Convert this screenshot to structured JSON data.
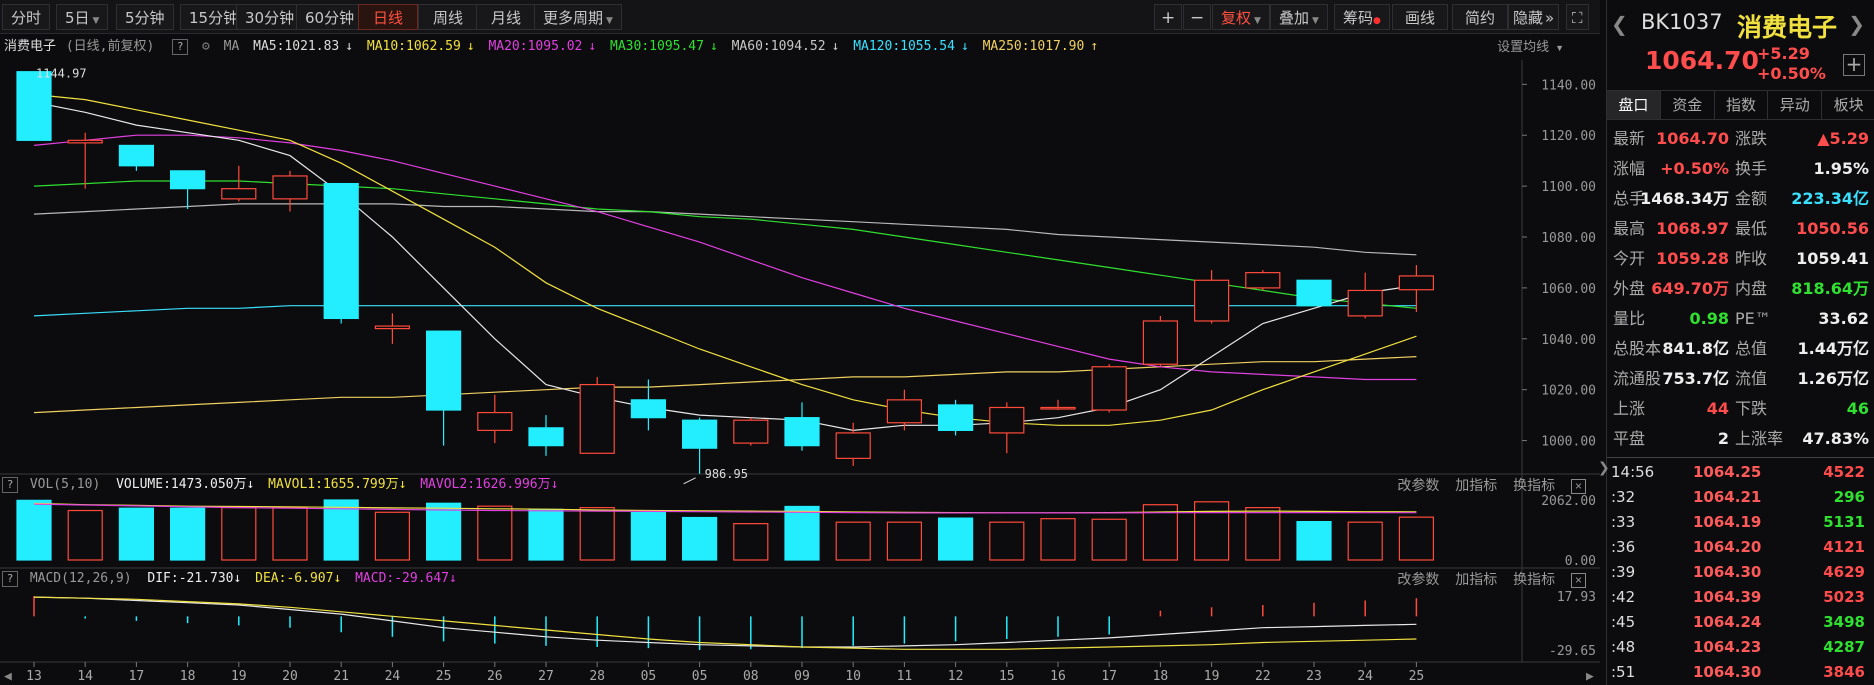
{
  "toolbar": {
    "periods": [
      "分时",
      "5日",
      "5分钟",
      "15分钟",
      "30分钟",
      "60分钟",
      "日线",
      "周线",
      "月线",
      "更多周期"
    ],
    "active_period": "日线",
    "fuquan": "复权",
    "diejia": "叠加",
    "chouma": "筹码",
    "huaxian": "画线",
    "jianyue": "简约",
    "yincang": "隐藏"
  },
  "ma": {
    "name": "消费电子",
    "mode": "(日线,前复权)",
    "label": "MA",
    "ma5": "MA5:1021.83",
    "ma10": "MA10:1062.59",
    "ma20": "MA20:1095.02",
    "ma30": "MA30:1095.47",
    "ma60": "MA60:1094.52",
    "ma120": "MA120:1055.54",
    "ma250": "MA250:1017.90",
    "settings": "设置均线"
  },
  "vol": {
    "title": "VOL(5,10)",
    "volume": "VOLUME:1473.050万",
    "mavol1": "MAVOL1:1655.799万",
    "mavol2": "MAVOL2:1626.996万",
    "ticks": [
      "2062.00",
      "0.00"
    ]
  },
  "macd": {
    "title": "MACD(12,26,9)",
    "dif": "DIF:-21.730",
    "dea": "DEA:-6.907",
    "macd": "MACD:-29.647",
    "ticks": [
      "17.93",
      "-29.65"
    ]
  },
  "sub_actions": [
    "改参数",
    "加指标",
    "换指标"
  ],
  "price_axis": [
    "1140.00",
    "1120.00",
    "1100.00",
    "1080.00",
    "1060.00",
    "1040.00",
    "1020.00",
    "1000.00"
  ],
  "annot": {
    "high": "1144.97",
    "low": "986.95"
  },
  "date_axis": [
    "13",
    "14",
    "17",
    "18",
    "19",
    "20",
    "21",
    "24",
    "25",
    "26",
    "27",
    "28",
    "05",
    "05",
    "08",
    "09",
    "10",
    "11",
    "12",
    "15",
    "16",
    "17",
    "18",
    "19",
    "22",
    "23",
    "24",
    "25"
  ],
  "chart_data": {
    "type": "candlestick",
    "title": "消费电子",
    "ylim": [
      990,
      1148
    ],
    "candles": [
      {
        "o": 1144.97,
        "h": 1144.97,
        "l": 1118,
        "c": 1118
      },
      {
        "o": 1117,
        "h": 1121,
        "l": 1099,
        "c": 1118
      },
      {
        "o": 1116,
        "h": 1116,
        "l": 1106,
        "c": 1108
      },
      {
        "o": 1106,
        "h": 1106,
        "l": 1091,
        "c": 1099
      },
      {
        "o": 1095,
        "h": 1108,
        "l": 1094,
        "c": 1099
      },
      {
        "o": 1095,
        "h": 1106,
        "l": 1090,
        "c": 1104
      },
      {
        "o": 1101,
        "h": 1101,
        "l": 1046,
        "c": 1048
      },
      {
        "o": 1044,
        "h": 1050,
        "l": 1038,
        "c": 1045
      },
      {
        "o": 1043,
        "h": 1043,
        "l": 998,
        "c": 1012
      },
      {
        "o": 1004,
        "h": 1018,
        "l": 999,
        "c": 1011
      },
      {
        "o": 1005,
        "h": 1010,
        "l": 994,
        "c": 998
      },
      {
        "o": 995,
        "h": 1025,
        "l": 995,
        "c": 1022
      },
      {
        "o": 1016,
        "h": 1024,
        "l": 1004,
        "c": 1009
      },
      {
        "o": 1008,
        "h": 1009,
        "l": 986.95,
        "c": 997
      },
      {
        "o": 999,
        "h": 1009,
        "l": 998,
        "c": 1008
      },
      {
        "o": 1009,
        "h": 1015,
        "l": 996,
        "c": 998
      },
      {
        "o": 993,
        "h": 1007,
        "l": 990,
        "c": 1003
      },
      {
        "o": 1007,
        "h": 1020,
        "l": 1004,
        "c": 1016
      },
      {
        "o": 1014,
        "h": 1016,
        "l": 1002,
        "c": 1004
      },
      {
        "o": 1003,
        "h": 1015,
        "l": 995,
        "c": 1013
      },
      {
        "o": 1013,
        "h": 1016,
        "l": 1012,
        "c": 1013
      },
      {
        "o": 1012,
        "h": 1030,
        "l": 1011,
        "c": 1029
      },
      {
        "o": 1030,
        "h": 1049,
        "l": 1029,
        "c": 1047
      },
      {
        "o": 1047,
        "h": 1067,
        "l": 1046,
        "c": 1063
      },
      {
        "o": 1060,
        "h": 1067,
        "l": 1059,
        "c": 1066
      },
      {
        "o": 1063,
        "h": 1063,
        "l": 1053,
        "c": 1053
      },
      {
        "o": 1049,
        "h": 1066,
        "l": 1048,
        "c": 1059
      },
      {
        "o": 1059.28,
        "h": 1068.97,
        "l": 1050.56,
        "c": 1064.7
      }
    ],
    "ma5": [
      1133,
      1129,
      1124,
      1121,
      1118,
      1112,
      1097,
      1080,
      1060,
      1040,
      1022,
      1017,
      1013,
      1010,
      1009,
      1008,
      1004,
      1006,
      1006,
      1007,
      1009,
      1013,
      1020,
      1033,
      1046,
      1052,
      1058,
      1061
    ],
    "ma10": [
      1136,
      1134,
      1130,
      1126,
      1122,
      1118,
      1109,
      1098,
      1087,
      1076,
      1062,
      1052,
      1044,
      1036,
      1029,
      1022,
      1016,
      1012,
      1009,
      1007,
      1006,
      1006,
      1008,
      1012,
      1020,
      1027,
      1034,
      1041
    ],
    "ma20": [
      1116,
      1118,
      1120,
      1120,
      1119,
      1117,
      1114,
      1110,
      1105,
      1100,
      1095,
      1090,
      1084,
      1078,
      1071,
      1064,
      1058,
      1052,
      1047,
      1042,
      1037,
      1032,
      1029,
      1027,
      1026,
      1025,
      1024,
      1024
    ],
    "ma30": [
      1100,
      1101,
      1102,
      1102,
      1102,
      1101,
      1100,
      1099,
      1097,
      1095,
      1093,
      1091,
      1090,
      1088,
      1087,
      1085,
      1083,
      1080,
      1077,
      1074,
      1071,
      1068,
      1065,
      1062,
      1059,
      1056,
      1054,
      1052
    ],
    "ma60": [
      1089,
      1090,
      1091,
      1092,
      1093,
      1093,
      1093,
      1093,
      1092,
      1092,
      1091,
      1090,
      1090,
      1089,
      1088,
      1087,
      1086,
      1085,
      1084,
      1083,
      1081,
      1080,
      1079,
      1078,
      1077,
      1076,
      1074,
      1073
    ],
    "ma120": [
      1049,
      1050,
      1051,
      1052,
      1052,
      1053,
      1053,
      1053,
      1053,
      1053,
      1053,
      1053,
      1053,
      1053,
      1053,
      1053,
      1053,
      1053,
      1053,
      1053,
      1053,
      1053,
      1053,
      1053,
      1053,
      1053,
      1053,
      1053
    ],
    "ma250": [
      1011,
      1012,
      1013,
      1014,
      1015,
      1016,
      1017,
      1017,
      1018,
      1019,
      1020,
      1021,
      1021,
      1022,
      1023,
      1024,
      1025,
      1025,
      1026,
      1027,
      1027,
      1028,
      1029,
      1030,
      1031,
      1031,
      1032,
      1033
    ],
    "volume": [
      2050,
      1700,
      1780,
      1780,
      1800,
      1800,
      2062,
      1640,
      1950,
      1850,
      1740,
      1800,
      1630,
      1460,
      1250,
      1840,
      1300,
      1300,
      1440,
      1300,
      1420,
      1400,
      1900,
      2000,
      1800,
      1320,
      1300,
      1473
    ],
    "mavol1": [
      1950,
      1900,
      1880,
      1850,
      1840,
      1830,
      1810,
      1790,
      1780,
      1760,
      1745,
      1720,
      1700,
      1690,
      1680,
      1670,
      1650,
      1640,
      1630,
      1620,
      1620,
      1630,
      1650,
      1670,
      1680,
      1670,
      1660,
      1656
    ],
    "mavol2": [
      1920,
      1890,
      1860,
      1830,
      1800,
      1780,
      1760,
      1740,
      1720,
      1700,
      1690,
      1680,
      1670,
      1660,
      1650,
      1640,
      1630,
      1620,
      1620,
      1620,
      1620,
      1620,
      1625,
      1630,
      1630,
      1628,
      1627,
      1627
    ],
    "macd_hist": [
      17.93,
      -2,
      -4,
      -6,
      -8,
      -10,
      -14,
      -18,
      -22,
      -24,
      -26,
      -27,
      -28,
      -29.65,
      -29,
      -28,
      -26,
      -24,
      -22,
      -20,
      -18,
      -16,
      5,
      8,
      10,
      12,
      14,
      16
    ],
    "dif": [
      17,
      16,
      14,
      12,
      10,
      6,
      2,
      -4,
      -10,
      -14,
      -18,
      -21,
      -23,
      -25,
      -26,
      -27,
      -27,
      -26,
      -25,
      -23,
      -21,
      -19,
      -16,
      -13,
      -10,
      -9,
      -8,
      -7
    ],
    "dea": [
      17,
      16,
      15,
      13,
      11,
      8,
      4,
      0,
      -4,
      -8,
      -12,
      -16,
      -20,
      -23,
      -25,
      -27,
      -28,
      -29,
      -29,
      -29,
      -28,
      -27,
      -26,
      -25,
      -23,
      -22,
      -21,
      -20
    ]
  },
  "quote": {
    "code": "BK1037",
    "name": "消费电子",
    "price": "1064.70",
    "change": "+5.29",
    "pct": "+0.50%",
    "tabs": [
      "盘口",
      "资金",
      "指数",
      "异动",
      "板块"
    ],
    "rows": [
      {
        "l": "最新",
        "v": "1064.70",
        "vc": "red",
        "l2": "涨跌",
        "v2": "▲5.29",
        "v2c": "red"
      },
      {
        "l": "涨幅",
        "v": "+0.50%",
        "vc": "red",
        "l2": "换手",
        "v2": "1.95%",
        "v2c": "wht"
      },
      {
        "l": "总手",
        "v": "1468.34万",
        "vc": "wht",
        "l2": "金额",
        "v2": "223.34亿",
        "v2c": "cya"
      },
      {
        "l": "最高",
        "v": "1068.97",
        "vc": "red",
        "l2": "最低",
        "v2": "1050.56",
        "v2c": "red"
      },
      {
        "l": "今开",
        "v": "1059.28",
        "vc": "red",
        "l2": "昨收",
        "v2": "1059.41",
        "v2c": "wht"
      },
      {
        "l": "外盘",
        "v": "649.70万",
        "vc": "red",
        "l2": "内盘",
        "v2": "818.64万",
        "v2c": "grn"
      },
      {
        "l": "量比",
        "v": "0.98",
        "vc": "grn",
        "l2": "PE™",
        "v2": "33.62",
        "v2c": "wht"
      },
      {
        "l": "总股本",
        "v": "841.8亿",
        "vc": "wht",
        "l2": "总值",
        "v2": "1.44万亿",
        "v2c": "wht"
      },
      {
        "l": "流通股",
        "v": "753.7亿",
        "vc": "wht",
        "l2": "流值",
        "v2": "1.26万亿",
        "v2c": "wht"
      },
      {
        "l": "上涨",
        "v": "44",
        "vc": "red",
        "l2": "下跌",
        "v2": "46",
        "v2c": "grn"
      },
      {
        "l": "平盘",
        "v": "2",
        "vc": "wht",
        "l2": "上涨率",
        "v2": "47.83%",
        "v2c": "wht"
      }
    ],
    "ticks": [
      {
        "t": "14:56",
        "p": "1064.25",
        "q": "4522",
        "qc": "red"
      },
      {
        "t": ":32",
        "p": "1064.21",
        "q": "296",
        "qc": "grn"
      },
      {
        "t": ":33",
        "p": "1064.19",
        "q": "5131",
        "qc": "grn"
      },
      {
        "t": ":36",
        "p": "1064.20",
        "q": "4121",
        "qc": "red"
      },
      {
        "t": ":39",
        "p": "1064.30",
        "q": "4629",
        "qc": "red"
      },
      {
        "t": ":42",
        "p": "1064.39",
        "q": "5023",
        "qc": "red"
      },
      {
        "t": ":45",
        "p": "1064.24",
        "q": "3498",
        "qc": "grn"
      },
      {
        "t": ":48",
        "p": "1064.23",
        "q": "4287",
        "qc": "grn"
      },
      {
        "t": ":51",
        "p": "1064.30",
        "q": "3846",
        "qc": "red"
      }
    ]
  }
}
